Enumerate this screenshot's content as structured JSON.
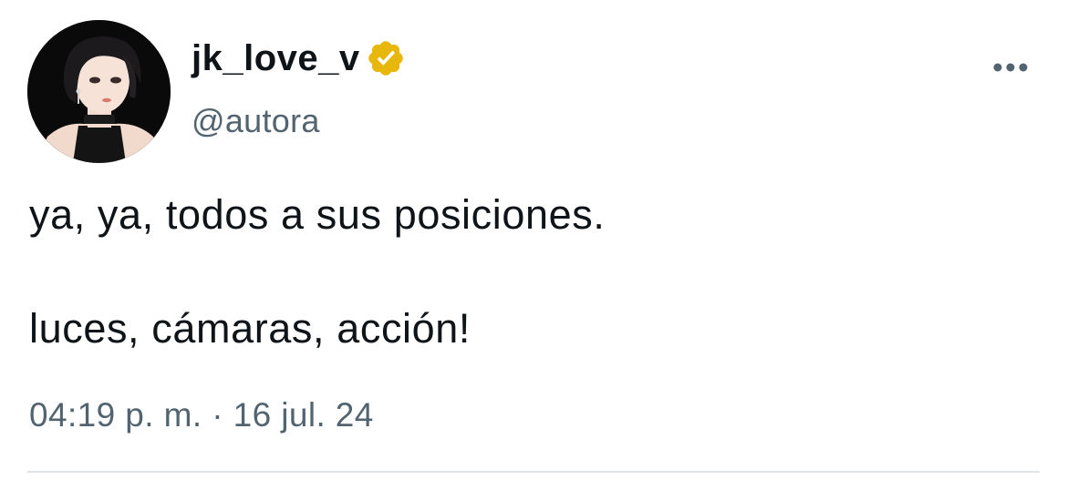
{
  "author": {
    "display_name": "jk_love_v",
    "handle": "@autora",
    "verified_badge_color": "#e8b70b",
    "avatar_icon": "user-avatar-illustration"
  },
  "menu": {
    "icon": "more-horizontal-icon"
  },
  "tweet": {
    "line_1": "ya, ya, todos a sus posiciones.",
    "line_2": "luces, cámaras, acción!",
    "timestamp": "04:19 p. m. · 16 jul. 24"
  },
  "colors": {
    "text_primary": "#0f1419",
    "text_secondary": "#536471",
    "divider": "#dfe3e6"
  }
}
